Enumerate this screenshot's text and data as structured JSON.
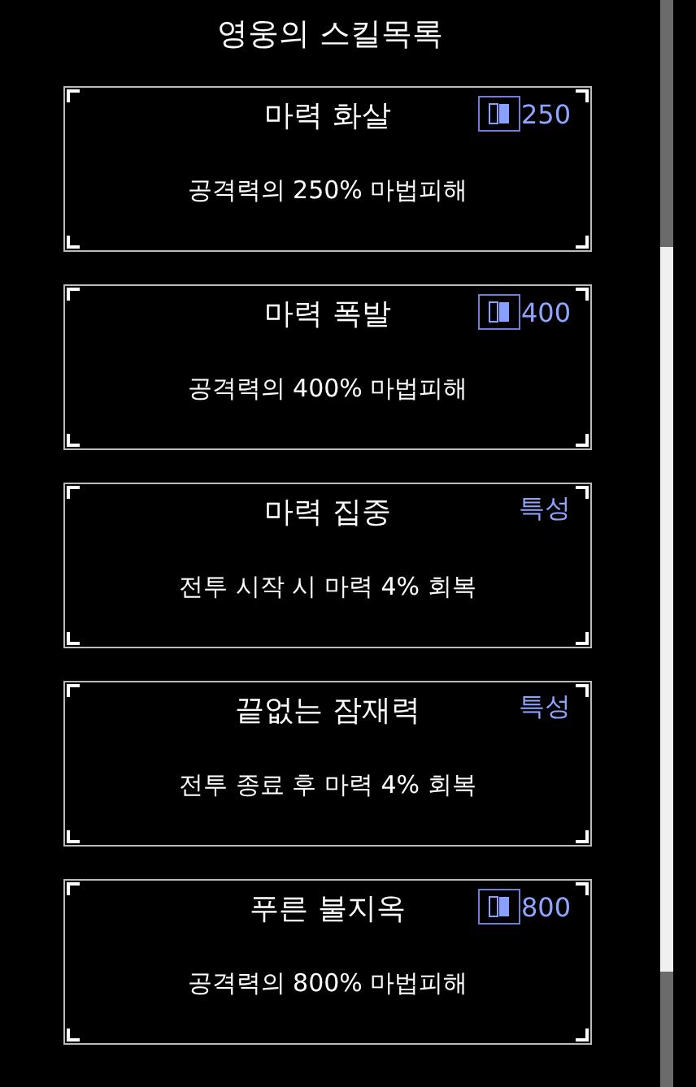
{
  "title": "영웅의 스킬목록",
  "skills": [
    {
      "name": "마력 화살",
      "kind": "cost",
      "tag": "250",
      "description": "공격력의 250% 마법피해"
    },
    {
      "name": "마력 폭발",
      "kind": "cost",
      "tag": "400",
      "description": "공격력의 400% 마법피해"
    },
    {
      "name": "마력 집중",
      "kind": "trait",
      "tag": "특성",
      "description": "전투 시작 시 마력 4% 회복"
    },
    {
      "name": "끝없는 잠재력",
      "kind": "trait",
      "tag": "특성",
      "description": "전투 종료 후 마력 4% 회복"
    },
    {
      "name": "푸른 불지옥",
      "kind": "cost",
      "tag": "800",
      "description": "공격력의 800% 마법피해"
    }
  ]
}
